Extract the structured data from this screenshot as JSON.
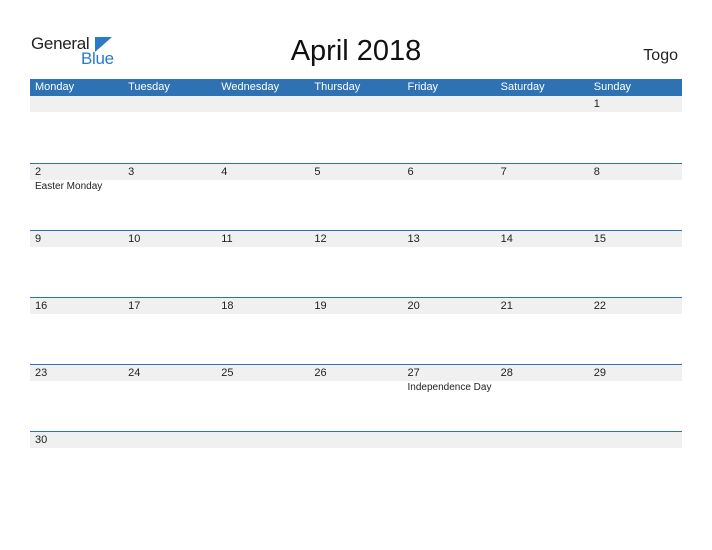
{
  "logo": {
    "line1": "General",
    "line2": "Blue",
    "icon": "triangle-flag-icon",
    "accent": "#2a7ac8"
  },
  "title": "April 2018",
  "country": "Togo",
  "colors": {
    "header_bg": "#2e72b4",
    "date_strip": "#f0f0f0"
  },
  "weekdays": [
    "Monday",
    "Tuesday",
    "Wednesday",
    "Thursday",
    "Friday",
    "Saturday",
    "Sunday"
  ],
  "weeks": [
    {
      "days": [
        {
          "d": ""
        },
        {
          "d": ""
        },
        {
          "d": ""
        },
        {
          "d": ""
        },
        {
          "d": ""
        },
        {
          "d": ""
        },
        {
          "d": "1"
        }
      ]
    },
    {
      "days": [
        {
          "d": "2",
          "holiday": "Easter Monday"
        },
        {
          "d": "3"
        },
        {
          "d": "4"
        },
        {
          "d": "5"
        },
        {
          "d": "6"
        },
        {
          "d": "7"
        },
        {
          "d": "8"
        }
      ]
    },
    {
      "days": [
        {
          "d": "9"
        },
        {
          "d": "10"
        },
        {
          "d": "11"
        },
        {
          "d": "12"
        },
        {
          "d": "13"
        },
        {
          "d": "14"
        },
        {
          "d": "15"
        }
      ]
    },
    {
      "days": [
        {
          "d": "16"
        },
        {
          "d": "17"
        },
        {
          "d": "18"
        },
        {
          "d": "19"
        },
        {
          "d": "20"
        },
        {
          "d": "21"
        },
        {
          "d": "22"
        }
      ]
    },
    {
      "days": [
        {
          "d": "23"
        },
        {
          "d": "24"
        },
        {
          "d": "25"
        },
        {
          "d": "26"
        },
        {
          "d": "27",
          "holiday": "Independence Day"
        },
        {
          "d": "28"
        },
        {
          "d": "29"
        }
      ]
    },
    {
      "days": [
        {
          "d": "30"
        },
        {
          "d": ""
        },
        {
          "d": ""
        },
        {
          "d": ""
        },
        {
          "d": ""
        },
        {
          "d": ""
        },
        {
          "d": ""
        }
      ]
    }
  ]
}
